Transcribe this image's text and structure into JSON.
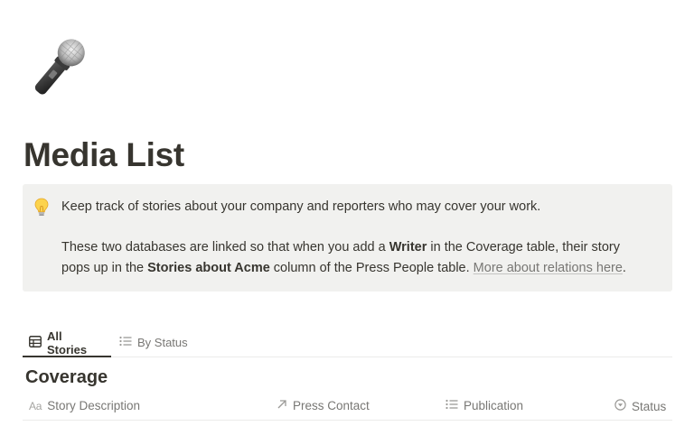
{
  "page": {
    "icon": "microphone-icon",
    "title": "Media List"
  },
  "callout": {
    "icon": "lightbulb-icon",
    "line1": "Keep track of stories about your company and reporters who may cover your work.",
    "line2_pre": "These two databases are linked so that when you add a ",
    "line2_bold": "Writer",
    "line2_post": " in the Coverage table, their story",
    "line3_pre": "pops up in the ",
    "line3_bold": "Stories about Acme",
    "line3_mid": " column of the Press People table. ",
    "line3_link": "More about relations here",
    "line3_end": "."
  },
  "views": {
    "tabs": [
      {
        "label": "All Stories",
        "icon": "table-icon",
        "active": true
      },
      {
        "label": "By Status",
        "icon": "list-icon",
        "active": false
      }
    ]
  },
  "database": {
    "title": "Coverage",
    "columns": [
      {
        "label": "Story Description",
        "icon": "text-property-icon",
        "icon_text": "Aa"
      },
      {
        "label": "Press Contact",
        "icon": "relation-arrow-icon"
      },
      {
        "label": "Publication",
        "icon": "list-icon"
      },
      {
        "label": "Status",
        "icon": "select-icon"
      }
    ]
  },
  "colors": {
    "text": "#37352f",
    "muted": "#787774",
    "callout_bg": "#f1f1ef",
    "divider": "#ebebea"
  }
}
